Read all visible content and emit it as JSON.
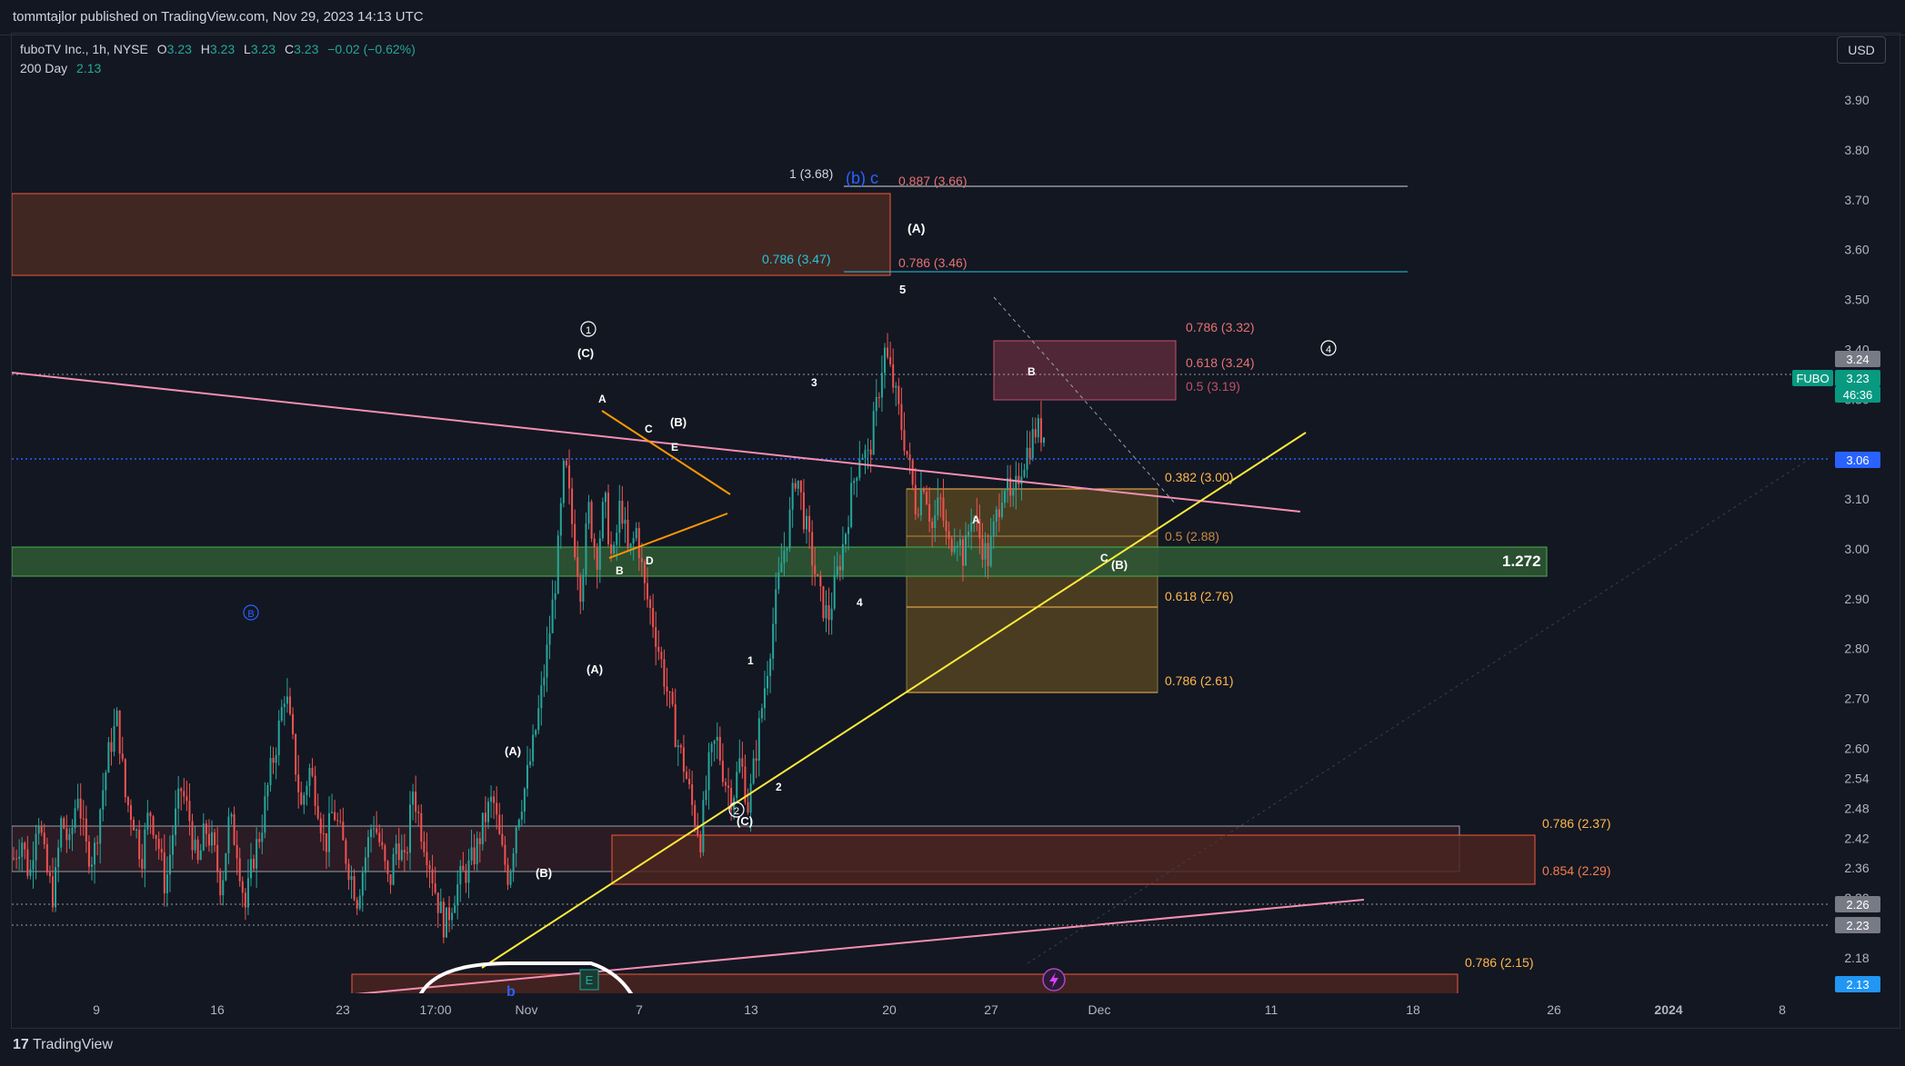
{
  "publisher": "tommtajlor published on TradingView.com, Nov 29, 2023 14:13 UTC",
  "brand": "TradingView",
  "legend": {
    "symbol": "fuboTV Inc., 1h, NYSE",
    "open_label": "O",
    "open": "3.23",
    "high_label": "H",
    "high": "3.23",
    "low_label": "L",
    "low": "3.23",
    "close_label": "C",
    "close": "3.23",
    "change": "−0.02 (−0.62%)",
    "indicator_label": "200 Day",
    "indicator_value": "2.13"
  },
  "currency": "USD",
  "price_scale": {
    "ticks": [
      "3.90",
      "3.80",
      "3.70",
      "3.60",
      "3.50",
      "3.40",
      "3.30",
      "3.10",
      "3.00",
      "2.90",
      "2.80",
      "2.70",
      "2.60",
      "2.54",
      "2.48",
      "2.42",
      "2.36",
      "2.30",
      "2.18"
    ],
    "badges": [
      {
        "text": "3.24",
        "color": "#787b86"
      },
      {
        "text": "FUBO",
        "color": "#089981"
      },
      {
        "text": "3.23",
        "color": "#089981"
      },
      {
        "text": "46:36",
        "color": "#089981"
      },
      {
        "text": "3.06",
        "color": "#2962ff"
      },
      {
        "text": "2.26",
        "color": "#787b86"
      },
      {
        "text": "2.23",
        "color": "#787b86"
      },
      {
        "text": "2.13",
        "color": "#2196f3"
      }
    ]
  },
  "time_scale": [
    "9",
    "16",
    "23",
    "17:00",
    "Nov",
    "7",
    "13",
    "20",
    "27",
    "Dec",
    "11",
    "18",
    "26",
    "2024",
    "8"
  ],
  "fib_labels": {
    "f1": "1 (3.68)",
    "f2": "0.887 (3.66)",
    "f3": "0.786 (3.47)",
    "f4": "0.786 (3.46)",
    "f5": "0.786 (3.32)",
    "f6": "0.618 (3.24)",
    "f7": "0.5 (3.19)",
    "f8": "0.382 (3.00)",
    "f9": "0.5 (2.88)",
    "f10": "0.618 (2.76)",
    "f11": "0.786 (2.61)",
    "f12": "0.786 (2.37)",
    "f13": "0.854 (2.29)",
    "f14": "0.786 (2.15)",
    "ext": "1.272"
  },
  "wave_labels": {
    "bc": "(b) c",
    "A_paren": "(A)",
    "five": "5",
    "circle1": "1",
    "C_paren_top": "(C)",
    "A_tri": "A",
    "C_tri": "C",
    "E_tri": "E",
    "B_paren_tri": "(B)",
    "B_tri": "B",
    "D_tri": "D",
    "three": "3",
    "four": "4",
    "B_small": "B",
    "circle4": "4",
    "A_small": "A",
    "C_small": "C",
    "B_paren_right": "(B)",
    "circleB": "B",
    "A_paren_low": "(A)",
    "one": "1",
    "two": "2",
    "circle2": "2",
    "C_paren_low": "(C)",
    "A_paren_left": "(A)",
    "B_paren_left": "(B)",
    "circleD_blue": "b",
    "E_badge": "E"
  },
  "chart_data": {
    "type": "candlestick",
    "symbol": "FUBO",
    "interval": "1h",
    "ylim": [
      2.13,
      3.97
    ],
    "y_ticks": [
      3.9,
      3.8,
      3.7,
      3.6,
      3.5,
      3.4,
      3.3,
      3.1,
      3.0,
      2.9,
      2.8,
      2.7,
      2.6,
      2.54,
      2.48,
      2.42,
      2.36,
      2.3,
      2.18
    ],
    "x_ticks": [
      "9",
      "16",
      "23",
      "17:00",
      "Nov",
      "7",
      "13",
      "20",
      "27",
      "Dec",
      "11",
      "18",
      "26",
      "2024",
      "8"
    ],
    "path": [
      [
        0,
        2.38
      ],
      [
        2,
        2.42
      ],
      [
        4,
        2.34
      ],
      [
        6,
        2.48
      ],
      [
        8,
        2.36
      ],
      [
        10,
        2.3
      ],
      [
        12,
        2.46
      ],
      [
        14,
        2.4
      ],
      [
        16,
        2.52
      ],
      [
        18,
        2.4
      ],
      [
        20,
        2.38
      ],
      [
        22,
        2.5
      ],
      [
        24,
        2.6
      ],
      [
        26,
        2.66
      ],
      [
        28,
        2.5
      ],
      [
        30,
        2.46
      ],
      [
        32,
        2.38
      ],
      [
        34,
        2.48
      ],
      [
        36,
        2.42
      ],
      [
        38,
        2.32
      ],
      [
        40,
        2.44
      ],
      [
        42,
        2.52
      ],
      [
        44,
        2.46
      ],
      [
        46,
        2.36
      ],
      [
        48,
        2.44
      ],
      [
        50,
        2.4
      ],
      [
        52,
        2.32
      ],
      [
        54,
        2.46
      ],
      [
        56,
        2.4
      ],
      [
        58,
        2.28
      ],
      [
        60,
        2.38
      ],
      [
        62,
        2.44
      ],
      [
        64,
        2.54
      ],
      [
        66,
        2.62
      ],
      [
        68,
        2.72
      ],
      [
        70,
        2.6
      ],
      [
        72,
        2.48
      ],
      [
        74,
        2.56
      ],
      [
        76,
        2.5
      ],
      [
        78,
        2.4
      ],
      [
        80,
        2.48
      ],
      [
        82,
        2.42
      ],
      [
        84,
        2.36
      ],
      [
        86,
        2.3
      ],
      [
        88,
        2.38
      ],
      [
        90,
        2.46
      ],
      [
        92,
        2.4
      ],
      [
        94,
        2.32
      ],
      [
        96,
        2.42
      ],
      [
        98,
        2.36
      ],
      [
        100,
        2.52
      ],
      [
        102,
        2.44
      ],
      [
        104,
        2.38
      ],
      [
        106,
        2.3
      ],
      [
        108,
        2.24
      ],
      [
        110,
        2.3
      ],
      [
        112,
        2.34
      ],
      [
        114,
        2.36
      ],
      [
        116,
        2.4
      ],
      [
        118,
        2.46
      ],
      [
        120,
        2.5
      ],
      [
        122,
        2.4
      ],
      [
        124,
        2.34
      ],
      [
        126,
        2.46
      ],
      [
        128,
        2.52
      ],
      [
        130,
        2.6
      ],
      [
        132,
        2.7
      ],
      [
        134,
        2.82
      ],
      [
        136,
        2.96
      ],
      [
        138,
        3.18
      ],
      [
        140,
        3.04
      ],
      [
        142,
        2.92
      ],
      [
        144,
        3.08
      ],
      [
        146,
        2.98
      ],
      [
        148,
        3.1
      ],
      [
        150,
        2.96
      ],
      [
        152,
        3.1
      ],
      [
        154,
        2.98
      ],
      [
        156,
        3.04
      ],
      [
        158,
        2.92
      ],
      [
        160,
        2.86
      ],
      [
        162,
        2.78
      ],
      [
        164,
        2.7
      ],
      [
        166,
        2.62
      ],
      [
        168,
        2.56
      ],
      [
        170,
        2.48
      ],
      [
        172,
        2.42
      ],
      [
        174,
        2.56
      ],
      [
        176,
        2.62
      ],
      [
        178,
        2.54
      ],
      [
        180,
        2.5
      ],
      [
        182,
        2.58
      ],
      [
        184,
        2.48
      ],
      [
        186,
        2.6
      ],
      [
        188,
        2.72
      ],
      [
        190,
        2.84
      ],
      [
        192,
        2.96
      ],
      [
        194,
        3.04
      ],
      [
        196,
        3.16
      ],
      [
        198,
        3.06
      ],
      [
        200,
        2.98
      ],
      [
        202,
        2.9
      ],
      [
        204,
        2.86
      ],
      [
        206,
        2.94
      ],
      [
        208,
        3.02
      ],
      [
        210,
        3.12
      ],
      [
        212,
        3.2
      ],
      [
        214,
        3.18
      ],
      [
        216,
        3.28
      ],
      [
        218,
        3.4
      ],
      [
        220,
        3.34
      ],
      [
        222,
        3.26
      ],
      [
        224,
        3.18
      ],
      [
        226,
        3.08
      ],
      [
        228,
        3.14
      ],
      [
        230,
        3.04
      ],
      [
        232,
        3.1
      ],
      [
        234,
        3.0
      ],
      [
        236,
        3.04
      ],
      [
        238,
        2.98
      ],
      [
        240,
        3.08
      ],
      [
        242,
        3.02
      ],
      [
        244,
        2.98
      ],
      [
        246,
        3.06
      ],
      [
        248,
        3.14
      ],
      [
        250,
        3.08
      ],
      [
        252,
        3.16
      ],
      [
        254,
        3.2
      ],
      [
        256,
        3.24
      ],
      [
        258,
        3.23
      ]
    ]
  }
}
